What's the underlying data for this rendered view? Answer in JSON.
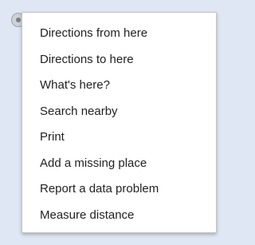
{
  "context_menu": {
    "items": [
      {
        "label": "Directions from here"
      },
      {
        "label": "Directions to here"
      },
      {
        "label": "What's here?"
      },
      {
        "label": "Search nearby"
      },
      {
        "label": "Print"
      },
      {
        "label": "Add a missing place"
      },
      {
        "label": "Report a data problem"
      },
      {
        "label": "Measure distance"
      }
    ]
  },
  "colors": {
    "map_background": "#dfe7f4",
    "menu_background": "#ffffff",
    "menu_text": "#222222"
  },
  "icons": {
    "marker": "map-pin-icon"
  }
}
